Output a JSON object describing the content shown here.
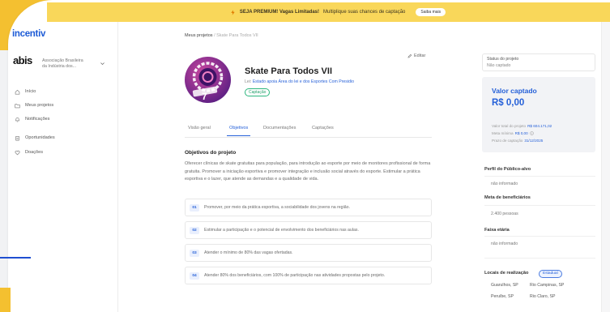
{
  "colors": {
    "brand_blue": "#1d5bd6",
    "banner_yellow": "#f9d75a",
    "frame_yellow": "#f4c030",
    "status_green": "#2cb67d"
  },
  "banner": {
    "icon": "lightning-icon",
    "highlight": "SEJA PREMIUM! Vagas Limitadas!",
    "text": "Multiplique suas chances de captação",
    "button_label": "Saiba mais"
  },
  "sidebar": {
    "logo_text": "incentiv",
    "org": {
      "logo_text": "abis",
      "name_line1": "Associação Brasileira",
      "name_line2": "da Indústria dos...",
      "icon": "chevron-down-icon"
    },
    "nav": [
      {
        "label": "Início",
        "icon": "home-icon"
      },
      {
        "label": "Meus projetos",
        "icon": "folder-icon"
      },
      {
        "label": "Notificações",
        "icon": "bell-icon"
      },
      {
        "label": "Oportunidades",
        "icon": "clipboard-icon"
      },
      {
        "label": "Doações",
        "icon": "heart-icon"
      }
    ]
  },
  "breadcrumb": {
    "parent": "Meus projetos",
    "separator": "/",
    "current": "Skate Para Todos VII"
  },
  "project": {
    "image_label": "7",
    "title": "Skate Para Todos VII",
    "law_label": "Lei:",
    "law_name": "Estado apoia Área do lei e dos Esportes Com Presidio",
    "status_badge": "Captação",
    "edit_label": "Editar"
  },
  "tabs": [
    {
      "label": "Visão geral",
      "active": false
    },
    {
      "label": "Objetivos",
      "active": true
    },
    {
      "label": "Documentações",
      "active": false
    },
    {
      "label": "Captações",
      "active": false
    }
  ],
  "objectives": {
    "title": "Objetivos do projeto",
    "description": "Oferecer clínicas de skate gratuitas para população, para introdução ao esporte por meio de monitores profissional de forma gratuita. Promover a iniciação esportiva e promover integração e inclusão social através do esporte. Estimular a prática esportiva e o lazer, que atende as demandas e a qualidade de vida.",
    "items": [
      {
        "number": "01",
        "text": "Promover, por meio da prática esportiva, a sociabilidade dos jovens na região."
      },
      {
        "number": "02",
        "text": "Estimular a participação e o potencial de envolvimento dos beneficiários nas aulas."
      },
      {
        "number": "03",
        "text": "Atender o mínimo de 80% das vagas ofertadas."
      },
      {
        "number": "04",
        "text": "Atender 80% dos beneficiários, com 100% de participação nas atividades propostas pelo projeto."
      }
    ]
  },
  "status": {
    "label": "Status do projeto",
    "value": "Não captado"
  },
  "funding": {
    "title": "Valor captado",
    "amount": "R$ 0,00",
    "rows": [
      {
        "label": "Valor total do projeto",
        "value": "R$ 604.171,02"
      },
      {
        "label": "Meta mínima",
        "value": "R$ 0,00",
        "icon": "info-icon"
      },
      {
        "label": "Prazo de captação",
        "value": "31/12/2025"
      }
    ]
  },
  "details": [
    {
      "label": "Perfil do Público-alvo",
      "value": "não informado"
    },
    {
      "label": "Meta de beneficiários",
      "value": "2.400 pessoas"
    },
    {
      "label": "Faixa etária",
      "value": "não informado"
    }
  ],
  "locations": {
    "title": "Locais de realização",
    "badge": "Estadual",
    "items": [
      "Guarulhos, SP",
      "Rio Campinas, SP",
      "Peruíbe, SP",
      "Rio Claro, SP"
    ]
  }
}
